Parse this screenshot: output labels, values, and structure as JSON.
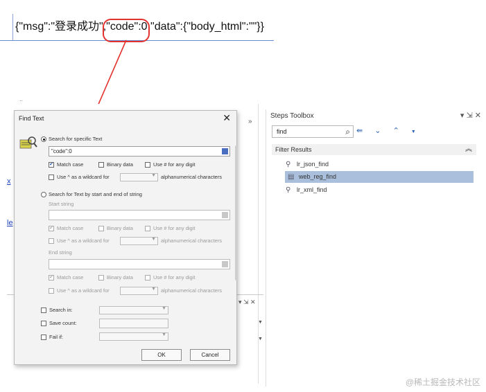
{
  "json_response": "{\"msg\":\"登录成功\",\"code\":0,\"data\":{\"body_html\":\"\"}}",
  "steps_toolbox": {
    "title": "Steps Toolbox",
    "search_value": "find",
    "filter_header": "Filter Results",
    "results": [
      "lr_json_find",
      "web_reg_find",
      "lr_xml_find"
    ],
    "selected_index": 1
  },
  "dialog": {
    "title": "Find Text",
    "search_specific": "Search for specific Text",
    "specific_value": "\"code\":0",
    "match_case": "Match case",
    "binary_data": "Binary data",
    "use_hash": "Use # for any digit",
    "use_caret": "Use ^ as a wildcard for",
    "alnum": "alphanumerical characters",
    "search_start_end": "Search for Text by start and end of string",
    "start_string": "Start string",
    "end_string": "End string",
    "search_in": "Search in:",
    "save_count": "Save count:",
    "fail_if": "Fail if:",
    "ok": "OK",
    "cancel": "Cancel"
  },
  "watermark": "@稀土掘金技术社区",
  "colors": {
    "annotation": "#e3322e",
    "selection": "#a9bfdc"
  }
}
